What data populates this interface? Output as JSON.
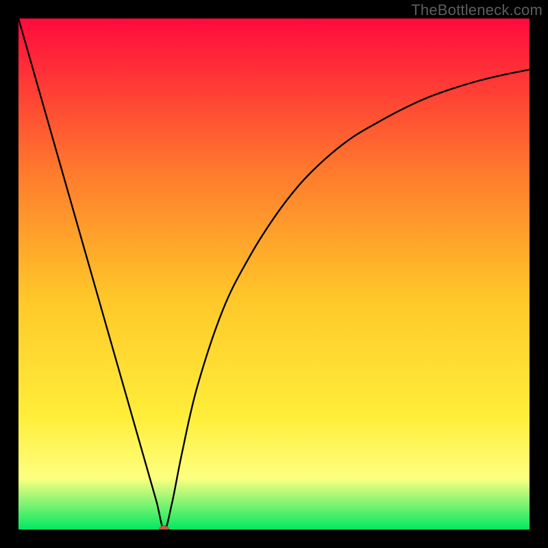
{
  "watermark": "TheBottleneck.com",
  "colors": {
    "frame": "#000000",
    "curve": "#000000",
    "gradient_top": "#ff0a3d",
    "gradient_mid_upper": "#ff7a2d",
    "gradient_mid": "#ffc829",
    "gradient_mid_lower": "#ffee3a",
    "gradient_band": "#fdff80",
    "gradient_bottom": "#00e863",
    "marker_fill": "#c25b4a",
    "marker_stroke": "#a6473a"
  },
  "chart_data": {
    "type": "line",
    "title": "",
    "xlabel": "",
    "ylabel": "",
    "xlim": [
      0,
      100
    ],
    "ylim": [
      0,
      100
    ],
    "grid": false,
    "legend": null,
    "series": [
      {
        "name": "bottleneck-curve",
        "x": [
          0,
          5,
          10,
          15,
          20,
          23,
          25,
          27,
          28.5,
          30,
          32,
          35,
          40,
          45,
          50,
          55,
          60,
          65,
          70,
          75,
          80,
          85,
          90,
          95,
          100
        ],
        "y": [
          100,
          82.5,
          65,
          47.5,
          30,
          19.5,
          12.5,
          5.5,
          0,
          5,
          15,
          28,
          43,
          53,
          61,
          67.5,
          72.5,
          76.5,
          79.5,
          82.2,
          84.5,
          86.3,
          87.8,
          89,
          90
        ]
      }
    ],
    "annotations": [
      {
        "name": "sweet-spot-marker",
        "x": 28.5,
        "y": 0
      }
    ]
  }
}
